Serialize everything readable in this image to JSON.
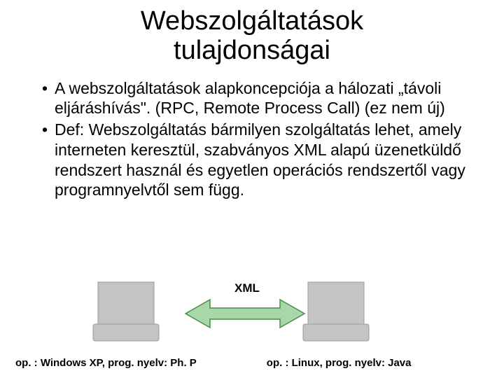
{
  "title_line1": "Webszolgáltatások",
  "title_line2": "tulajdonságai",
  "bullets": [
    "A webszolgáltatások alapkoncepciója a hálozati „távoli eljáráshívás\". (RPC, Remote Process Call) (ez nem új)",
    "Def: Webszolgáltatás bármilyen szolgáltatás lehet, amely interneten keresztül, szabványos XML alapú üzenetküldő rendszert használ és egyetlen operációs rendszertől vagy programnyelvtől sem függ."
  ],
  "diagram": {
    "protocol_label": "XML",
    "left_caption": "op. : Windows XP, prog. nyelv: Ph. P",
    "right_caption": "op. : Linux, prog. nyelv: Java"
  }
}
